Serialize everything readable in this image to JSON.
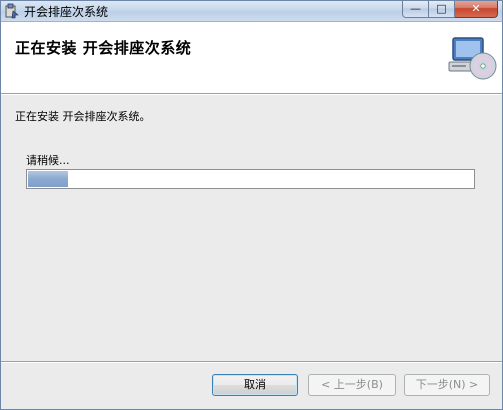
{
  "window": {
    "title": "开会排座次系统",
    "icon": "installer-app-icon",
    "controls": {
      "minimize": "—",
      "maximize": "□",
      "close": "✕"
    }
  },
  "header": {
    "title": "正在安装  开会排座次系统",
    "icon": "computer-cd-icon"
  },
  "main": {
    "status": "正在安装 开会排座次系统。",
    "wait_label": "请稍候...",
    "progress": 0.09
  },
  "footer": {
    "cancel_label": "取消",
    "back_label": "< 上一步(B)",
    "next_label": "下一步(N) >"
  },
  "colors": {
    "progress_fill": "#8ca9d2",
    "panel_bg": "#ebebeb",
    "titlebar": "#c7d8ec",
    "close_button": "#c7472f"
  }
}
